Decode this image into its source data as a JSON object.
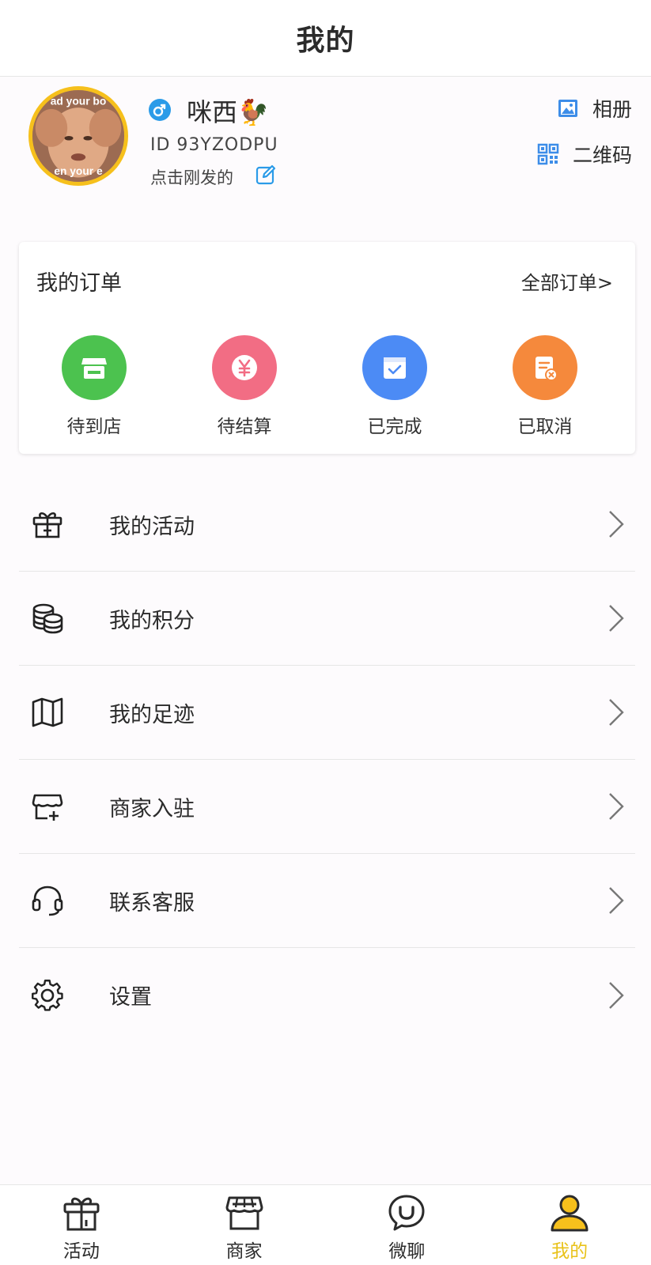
{
  "header": {
    "title": "我的"
  },
  "profile": {
    "avatar_caption_top": "ad your bo",
    "avatar_caption_bottom": "en your e",
    "nickname": "咪西🐓",
    "user_id": "ID 93YZODPU",
    "signature": "点击刚发的",
    "album_label": "相册",
    "qrcode_label": "二维码",
    "gender": "male"
  },
  "orders": {
    "title": "我的订单",
    "all_label": "全部订单>",
    "items": [
      {
        "label": "待到店",
        "icon": "store-icon",
        "color": "#4cc24f"
      },
      {
        "label": "待结算",
        "icon": "yen-icon",
        "color": "#f26d84"
      },
      {
        "label": "已完成",
        "icon": "calendar-check-icon",
        "color": "#4c8bf5"
      },
      {
        "label": "已取消",
        "icon": "receipt-cancel-icon",
        "color": "#f5893c"
      }
    ]
  },
  "menu": {
    "items": [
      {
        "label": "我的活动",
        "icon": "gift-icon"
      },
      {
        "label": "我的积分",
        "icon": "coins-icon"
      },
      {
        "label": "我的足迹",
        "icon": "map-icon"
      },
      {
        "label": "商家入驻",
        "icon": "store-add-icon"
      },
      {
        "label": "联系客服",
        "icon": "headset-icon"
      },
      {
        "label": "设置",
        "icon": "gear-icon"
      }
    ]
  },
  "tabbar": {
    "active_color": "#e9c21a",
    "items": [
      {
        "label": "活动",
        "icon": "gift-icon"
      },
      {
        "label": "商家",
        "icon": "store-icon"
      },
      {
        "label": "微聊",
        "icon": "chat-icon"
      },
      {
        "label": "我的",
        "icon": "user-icon"
      }
    ]
  }
}
